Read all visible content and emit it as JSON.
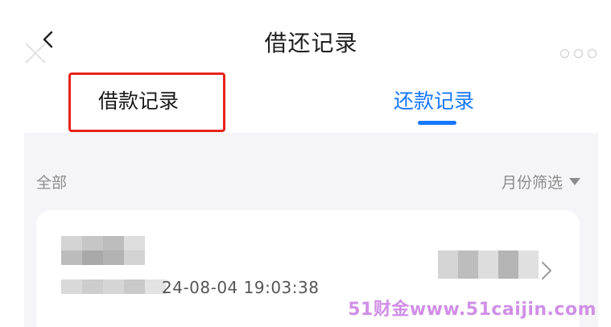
{
  "header": {
    "title": "借还记录",
    "back_icon": "back-arrow-icon",
    "more_icon": "more-dots-icon"
  },
  "tabs": [
    {
      "label": "借款记录",
      "active": false,
      "highlighted": true
    },
    {
      "label": "还款记录",
      "active": true
    }
  ],
  "filters": {
    "all_label": "全部",
    "month_label": "月份筛选",
    "month_icon": "caret-down-icon"
  },
  "record": {
    "date_visible": "24-08-04 19:03:38",
    "arrow_icon": "chevron-right-icon",
    "redacted": true
  },
  "watermark": {
    "text": "51财金www.51caijin.com"
  },
  "colors": {
    "accent": "#1677ff",
    "highlight_border": "#e8231b",
    "background": "#f5f5f7",
    "card": "#ffffff",
    "muted_text": "#8c8c8c",
    "watermark": "#d08fe6"
  }
}
